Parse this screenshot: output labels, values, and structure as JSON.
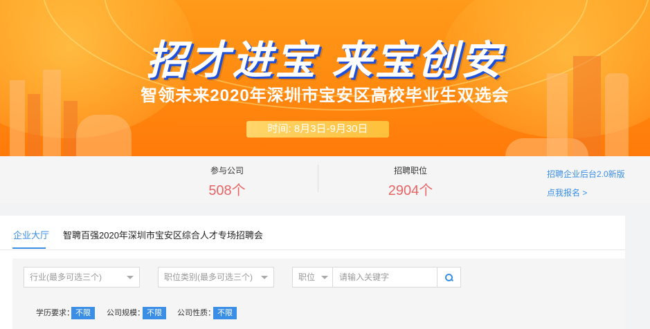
{
  "banner": {
    "slogan": "招才进宝 来宝创安",
    "subtitle": "智领未来2020年深圳市宝安区高校毕业生双选会",
    "date_label": "时间:",
    "date_range": "8月3日-9月30日"
  },
  "stats": {
    "companies": {
      "label": "参与公司",
      "value": "508个"
    },
    "positions": {
      "label": "招聘职位",
      "value": "2904个"
    },
    "links": {
      "backend": "招聘企业后台2.0新版",
      "signup": "点我报名 >"
    }
  },
  "tabs": [
    {
      "label": "企业大厅",
      "active": true
    },
    {
      "label": "智聘百强2020年深圳市宝安区综合人才专场招聘会",
      "active": false
    }
  ],
  "filters": {
    "industry_placeholder": "行业(最多可选三个)",
    "category_placeholder": "职位类别(最多可选三个)",
    "position_select": "职位",
    "search_placeholder": "请输入关键字",
    "education": {
      "label": "学历要求：",
      "value": "不限"
    },
    "scale": {
      "label": "公司规模：",
      "value": "不限"
    },
    "nature": {
      "label": "公司性质：",
      "value": "不限"
    }
  },
  "colors": {
    "accent": "#3a8ee6",
    "stat_value": "#e86464",
    "banner": "#ff8a10"
  }
}
